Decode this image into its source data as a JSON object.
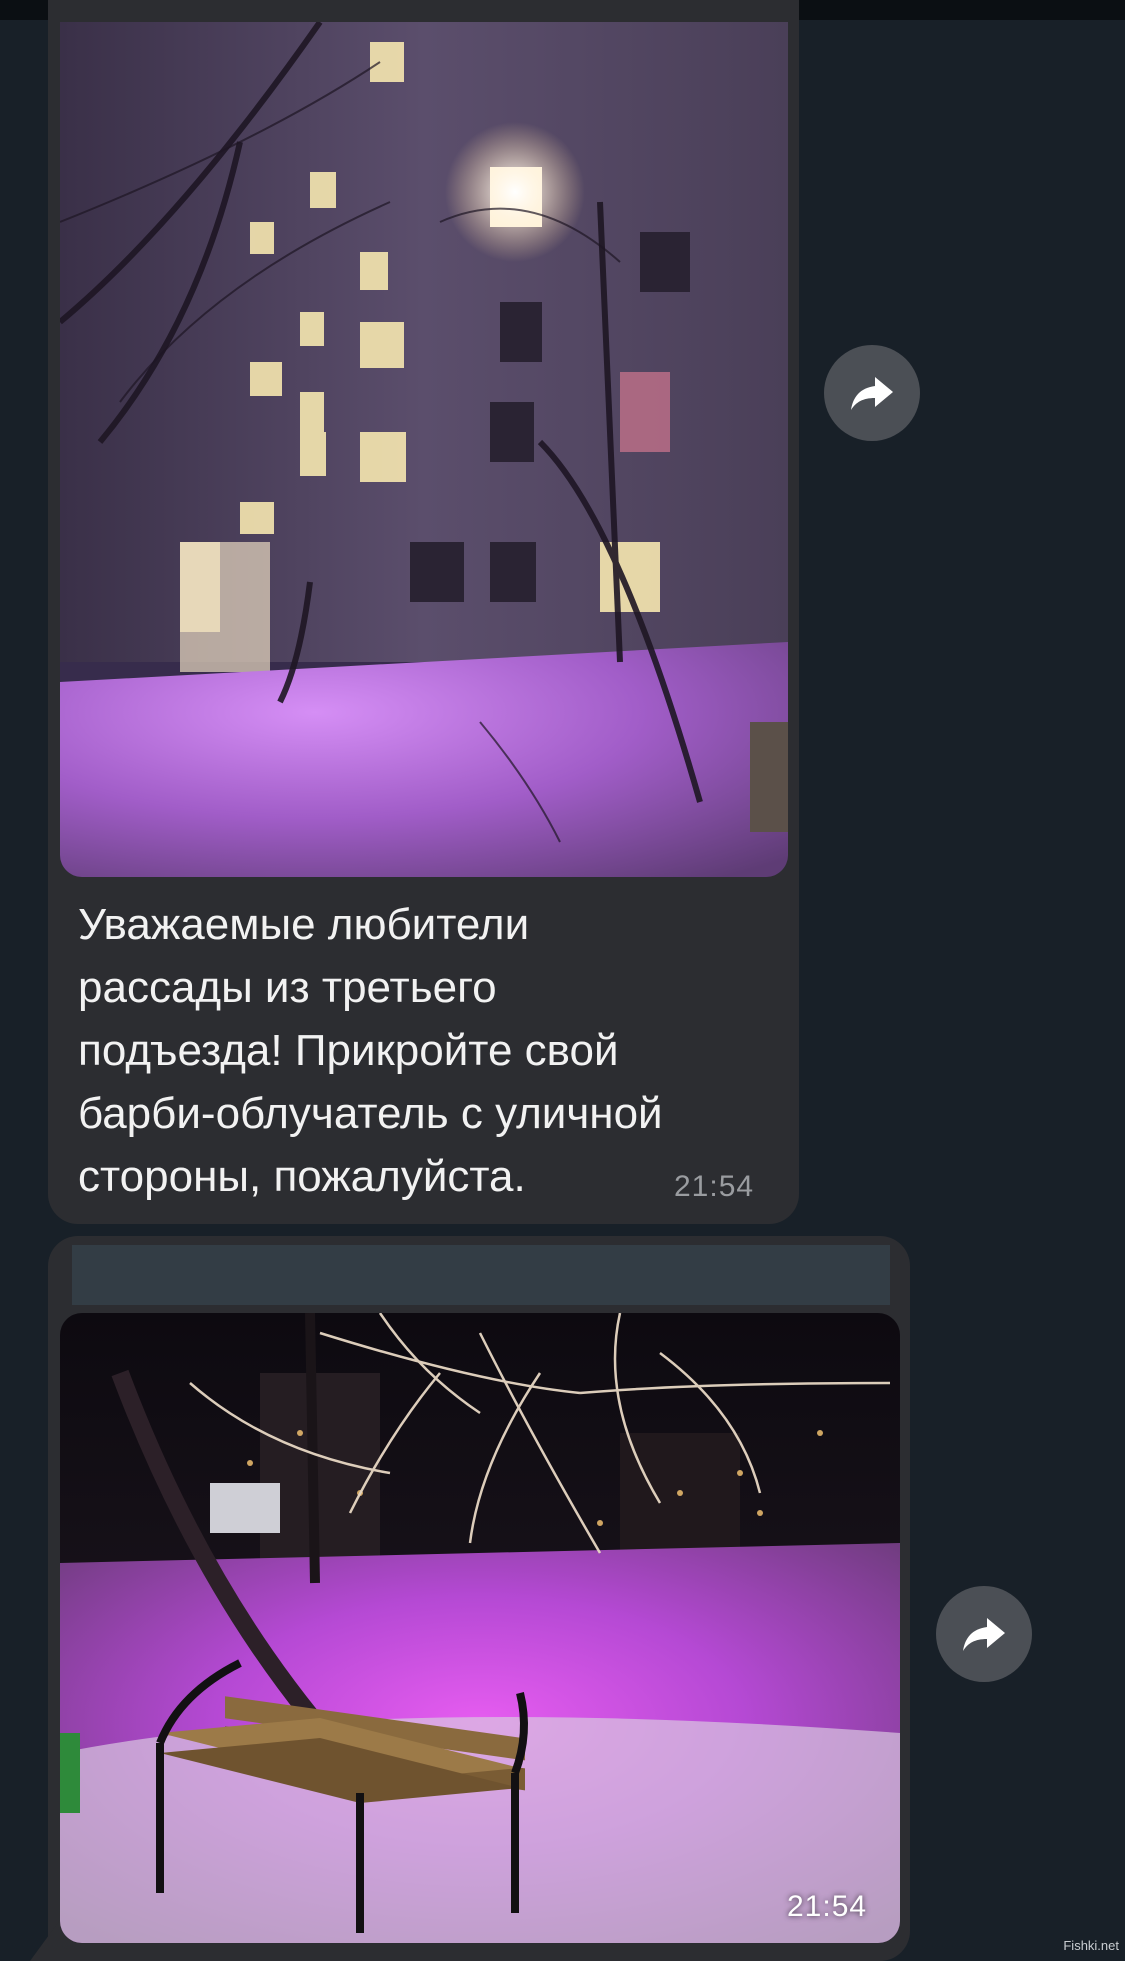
{
  "messages": [
    {
      "caption": "Уважаемые любители\nрассады из третьего\nподъезда! Прикройте свой\nбарби-облучатель с уличной\nстороны, пожалуйста.",
      "time": "21:54"
    },
    {
      "time": "21:54"
    }
  ],
  "icons": {
    "share": "share-arrow-icon"
  },
  "watermark": "Fishki.net",
  "colors": {
    "background": "#182028",
    "bubble": "#2c2d31",
    "accent_purple": "#b04be0"
  }
}
